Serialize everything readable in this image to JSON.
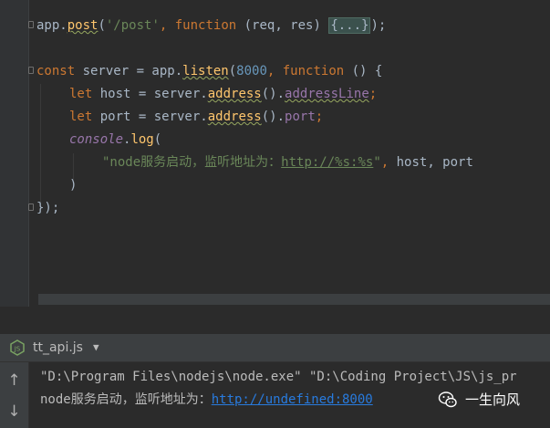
{
  "editor": {
    "lines": [
      {
        "tokens": [
          {
            "t": "app.",
            "c": ""
          },
          {
            "t": "post",
            "c": "fn wave"
          },
          {
            "t": "(",
            "c": ""
          },
          {
            "t": "'/post'",
            "c": "str"
          },
          {
            "t": ", ",
            "c": "kw"
          },
          {
            "t": "function ",
            "c": "kw"
          },
          {
            "t": "(req, res) ",
            "c": ""
          },
          {
            "t": "{...}",
            "c": "folded"
          },
          {
            "t": ");",
            "c": ""
          }
        ]
      },
      {
        "tokens": []
      },
      {
        "tokens": [
          {
            "t": "const ",
            "c": "kw"
          },
          {
            "t": "server = app.",
            "c": ""
          },
          {
            "t": "listen",
            "c": "fn wave"
          },
          {
            "t": "(",
            "c": ""
          },
          {
            "t": "8000",
            "c": "num"
          },
          {
            "t": ", ",
            "c": "kw"
          },
          {
            "t": "function ",
            "c": "kw"
          },
          {
            "t": "() {",
            "c": ""
          }
        ]
      },
      {
        "tokens": [
          {
            "t": "let ",
            "c": "kw"
          },
          {
            "t": "host = server.",
            "c": ""
          },
          {
            "t": "address",
            "c": "fn wave"
          },
          {
            "t": "().",
            "c": ""
          },
          {
            "t": "addressLine",
            "c": "prop wave"
          },
          {
            "t": ";",
            "c": "kw"
          }
        ]
      },
      {
        "tokens": [
          {
            "t": "let ",
            "c": "kw"
          },
          {
            "t": "port = server.",
            "c": ""
          },
          {
            "t": "address",
            "c": "fn wave"
          },
          {
            "t": "().",
            "c": ""
          },
          {
            "t": "port",
            "c": "prop"
          },
          {
            "t": ";",
            "c": "kw"
          }
        ]
      },
      {
        "tokens": [
          {
            "t": "console",
            "c": "prop italic"
          },
          {
            "t": ".",
            "c": ""
          },
          {
            "t": "log",
            "c": "fn"
          },
          {
            "t": "(",
            "c": ""
          }
        ]
      },
      {
        "tokens": [
          {
            "t": "\"node服务启动，监听地址为：",
            "c": "str"
          },
          {
            "t": "http://%s:%s",
            "c": "str link"
          },
          {
            "t": "\"",
            "c": "str"
          },
          {
            "t": ", ",
            "c": "kw"
          },
          {
            "t": "host, port",
            "c": ""
          }
        ]
      },
      {
        "tokens": [
          {
            "t": ")",
            "c": ""
          }
        ]
      },
      {
        "tokens": [
          {
            "t": "});",
            "c": ""
          }
        ]
      }
    ]
  },
  "run_panel": {
    "tab_label": "tt_api.js",
    "tab_icon": "nodejs-icon",
    "tools": [
      {
        "icon": "arrow-up-icon",
        "glyph": "↑"
      },
      {
        "icon": "arrow-down-icon",
        "glyph": "↓"
      }
    ],
    "console": {
      "line1": "\"D:\\Program Files\\nodejs\\node.exe\" \"D:\\Coding Project\\JS\\js_pr",
      "line2_prefix": "node服务启动，监听地址为：",
      "line2_link": "http://undefined:8000"
    }
  },
  "watermark": {
    "text": "一生向风",
    "icon": "wechat-icon"
  }
}
